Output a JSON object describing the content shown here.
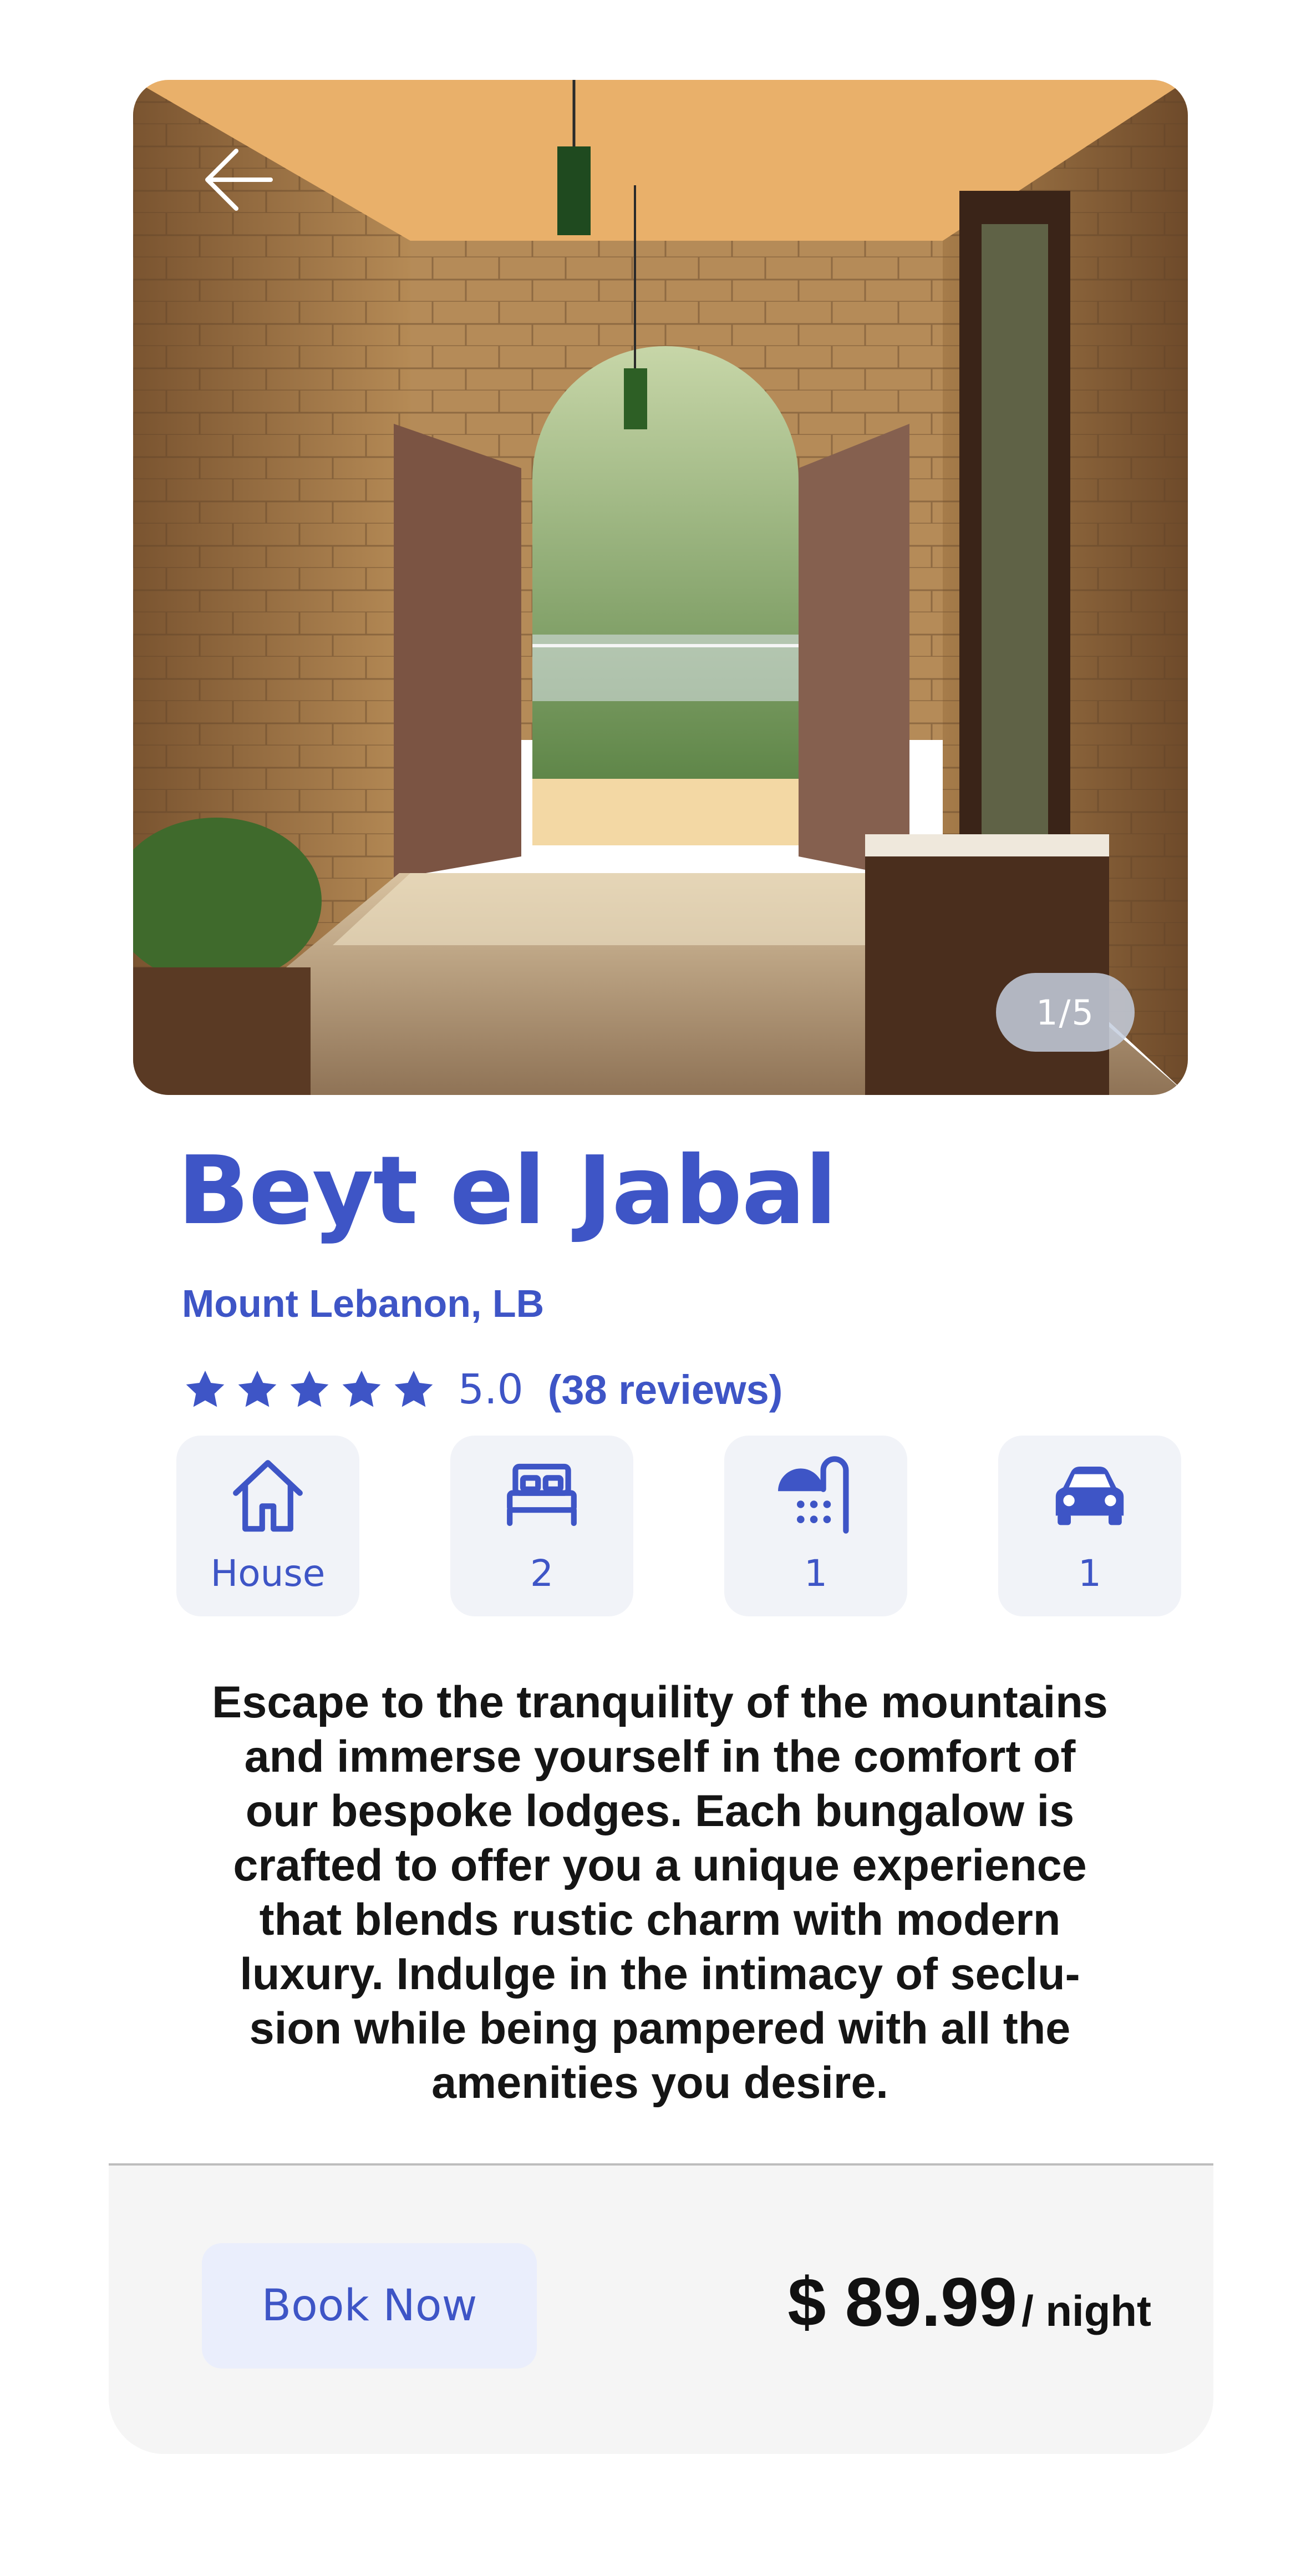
{
  "hero": {
    "photo_counter": "1/5",
    "back_icon": "arrow-left-icon"
  },
  "listing": {
    "title": "Beyt el Jabal",
    "location": "Mount Lebanon, LB",
    "rating_stars": 5,
    "rating": "5.0",
    "reviews": "(38 reviews)"
  },
  "features": [
    {
      "icon": "house-icon",
      "label": "House"
    },
    {
      "icon": "bed-icon",
      "label": "2"
    },
    {
      "icon": "shower-icon",
      "label": "1"
    },
    {
      "icon": "car-icon",
      "label": "1"
    }
  ],
  "description_lines": [
    "Escape to the tranquility of the mountains",
    "and immerse yourself in the comfort of",
    "our bespoke lodges. Each bungalow is",
    "crafted to offer you a unique  experience",
    "that blends rustic charm with modern",
    "luxury. Indulge in the intimacy of seclu-",
    "sion while being  pampered with all the",
    "amenities you desire."
  ],
  "booking": {
    "button_label": "Book Now",
    "price": "$ 89.99",
    "price_unit": "/ night"
  },
  "colors": {
    "accent": "#3e55c6",
    "feature_bg": "#f1f3f8",
    "button_bg": "#eaeefc",
    "footer_bg": "#f5f5f5"
  }
}
